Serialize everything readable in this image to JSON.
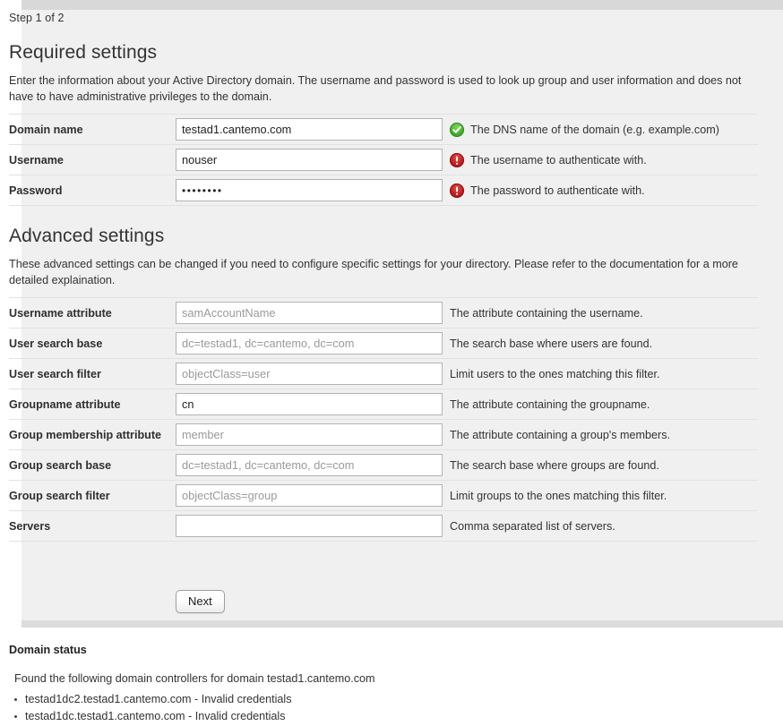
{
  "step_label": "Step 1 of 2",
  "required": {
    "title": "Required settings",
    "description": "Enter the information about your Active Directory domain. The username and password is used to look up group and user information and does not have to have administrative privileges to the domain.",
    "rows": [
      {
        "label": "Domain name",
        "value": "testad1.cantemo.com",
        "placeholder": "",
        "help": "The DNS name of the domain (e.g. example.com)",
        "status": "ok",
        "status_icon": "check-circle-icon",
        "type": "text"
      },
      {
        "label": "Username",
        "value": "nouser",
        "placeholder": "",
        "help": "The username to authenticate with.",
        "status": "error",
        "status_icon": "error-circle-icon",
        "type": "text"
      },
      {
        "label": "Password",
        "value": "••••••••",
        "placeholder": "",
        "help": "The password to authenticate with.",
        "status": "error",
        "status_icon": "error-circle-icon",
        "type": "password"
      }
    ]
  },
  "advanced": {
    "title": "Advanced settings",
    "description": "These advanced settings can be changed if you need to configure specific settings for your directory. Please refer to the documentation for a more detailed explaination.",
    "rows": [
      {
        "label": "Username attribute",
        "value": "",
        "placeholder": "samAccountName",
        "help": "The attribute containing the username."
      },
      {
        "label": "User search base",
        "value": "",
        "placeholder": "dc=testad1, dc=cantemo, dc=com",
        "help": "The search base where users are found."
      },
      {
        "label": "User search filter",
        "value": "",
        "placeholder": "objectClass=user",
        "help": "Limit users to the ones matching this filter."
      },
      {
        "label": "Groupname attribute",
        "value": "cn",
        "placeholder": "",
        "help": "The attribute containing the groupname."
      },
      {
        "label": "Group membership attribute",
        "value": "",
        "placeholder": "member",
        "help": "The attribute containing a group's members."
      },
      {
        "label": "Group search base",
        "value": "",
        "placeholder": "dc=testad1, dc=cantemo, dc=com",
        "help": "The search base where groups are found."
      },
      {
        "label": "Group search filter",
        "value": "",
        "placeholder": "objectClass=group",
        "help": "Limit groups to the ones matching this filter."
      },
      {
        "label": "Servers",
        "value": "",
        "placeholder": "",
        "help": "Comma separated list of servers."
      }
    ]
  },
  "next_button_label": "Next",
  "domain_status": {
    "title": "Domain status",
    "summary": "Found the following domain controllers for domain testad1.cantemo.com",
    "controllers": [
      "testad1dc2.testad1.cantemo.com - Invalid credentials",
      "testad1dc.testad1.cantemo.com - Invalid credentials"
    ]
  },
  "colors": {
    "panel_bg": "#f0f0f0",
    "strip": "#d8d8d8",
    "ok_green": "#3faa29",
    "error_red": "#c01717",
    "text": "#333333"
  }
}
